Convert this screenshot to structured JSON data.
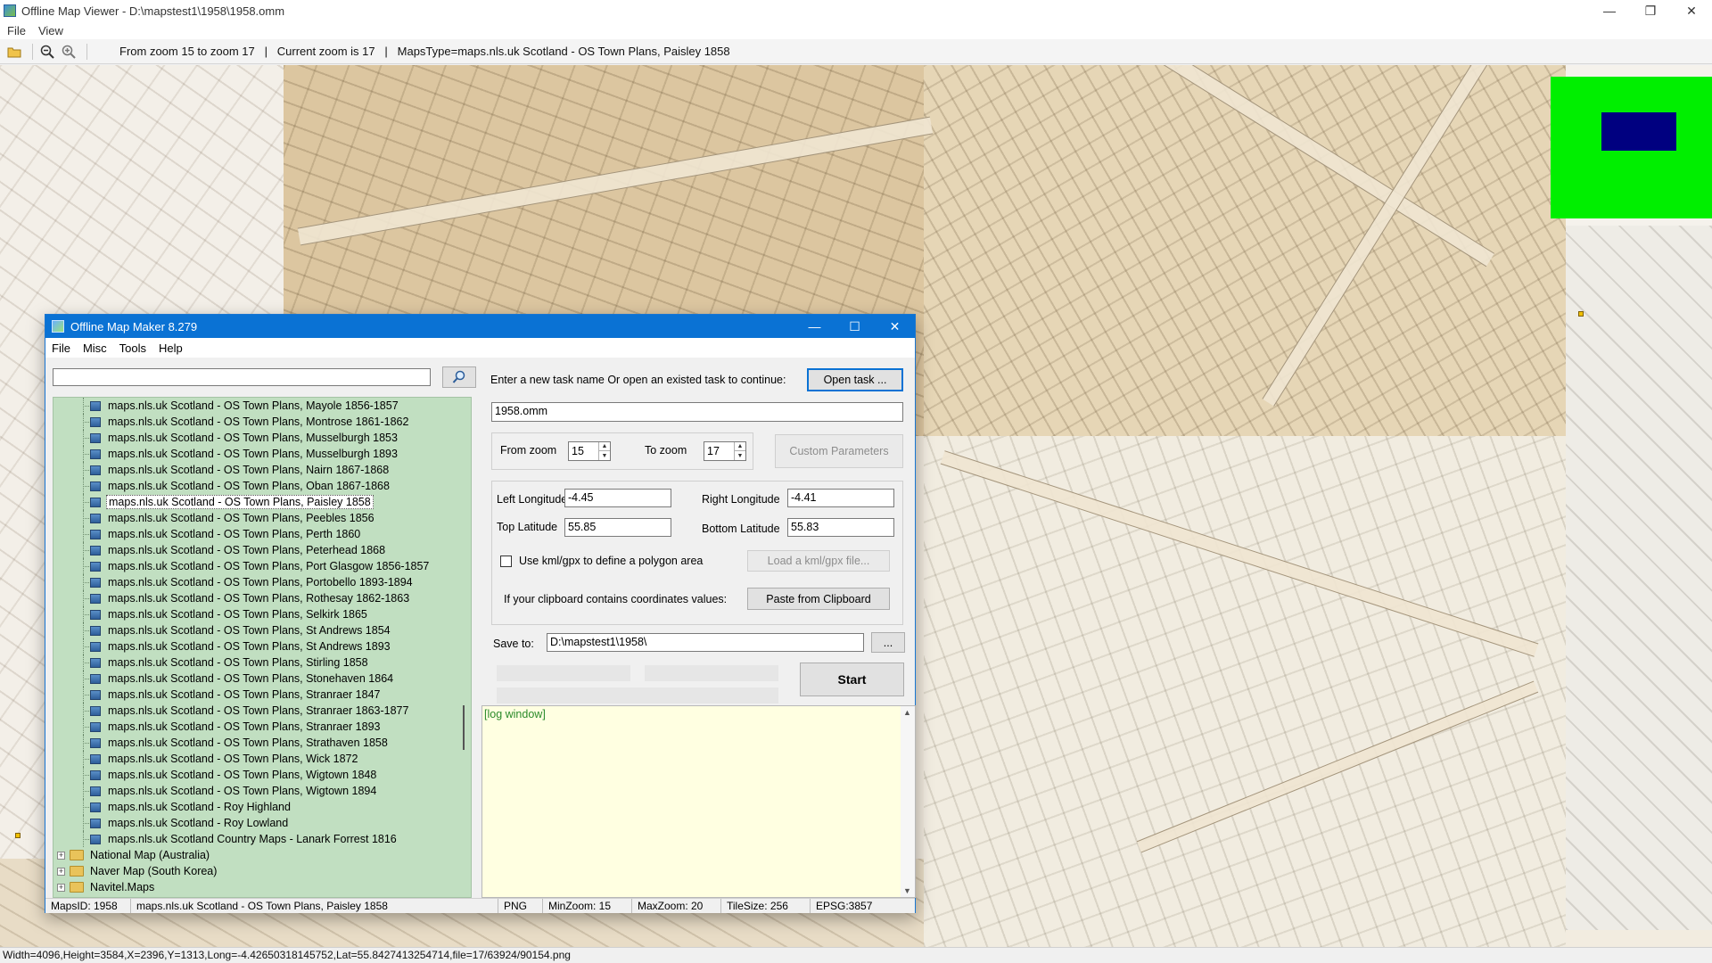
{
  "viewer": {
    "title": "Offline Map Viewer - D:\\mapstest1\\1958\\1958.omm",
    "menu": [
      "File",
      "View"
    ],
    "window_controls": {
      "minimize": "—",
      "maximize": "❐",
      "close": "✕"
    },
    "toolbar_status": "From zoom 15 to zoom 17   |   Current zoom is 17   |   MapsType=maps.nls.uk Scotland - OS Town Plans, Paisley 1858",
    "statusbar": "Width=4096,Height=3584,X=2396,Y=1313,Long=-4.42650318145752,Lat=55.8427413254714,file=17/63924/90154.png",
    "overview_colors": {
      "background": "#00ef00",
      "viewport": "#000080"
    }
  },
  "dialog": {
    "title": "Offline Map Maker 8.279",
    "menu": [
      "File",
      "Misc",
      "Tools",
      "Help"
    ],
    "window_controls": {
      "minimize": "—",
      "maximize": "☐",
      "close": "✕"
    },
    "search": {
      "value": "",
      "icon": "magnifier-icon"
    },
    "tree": {
      "maps": [
        "maps.nls.uk Scotland - OS Town Plans, Mayole 1856-1857",
        "maps.nls.uk Scotland - OS Town Plans, Montrose 1861-1862",
        "maps.nls.uk Scotland - OS Town Plans, Musselburgh 1853",
        "maps.nls.uk Scotland - OS Town Plans, Musselburgh 1893",
        "maps.nls.uk Scotland - OS Town Plans, Nairn 1867-1868",
        "maps.nls.uk Scotland - OS Town Plans, Oban 1867-1868",
        "maps.nls.uk Scotland - OS Town Plans, Paisley 1858",
        "maps.nls.uk Scotland - OS Town Plans, Peebles 1856",
        "maps.nls.uk Scotland - OS Town Plans, Perth 1860",
        "maps.nls.uk Scotland - OS Town Plans, Peterhead 1868",
        "maps.nls.uk Scotland - OS Town Plans, Port Glasgow 1856-1857",
        "maps.nls.uk Scotland - OS Town Plans, Portobello 1893-1894",
        "maps.nls.uk Scotland - OS Town Plans, Rothesay 1862-1863",
        "maps.nls.uk Scotland - OS Town Plans, Selkirk 1865",
        "maps.nls.uk Scotland - OS Town Plans, St Andrews 1854",
        "maps.nls.uk Scotland - OS Town Plans, St Andrews 1893",
        "maps.nls.uk Scotland - OS Town Plans, Stirling 1858",
        "maps.nls.uk Scotland - OS Town Plans, Stonehaven 1864",
        "maps.nls.uk Scotland - OS Town Plans, Stranraer 1847",
        "maps.nls.uk Scotland - OS Town Plans, Stranraer 1863-1877",
        "maps.nls.uk Scotland - OS Town Plans, Stranraer 1893",
        "maps.nls.uk Scotland - OS Town Plans, Strathaven 1858",
        "maps.nls.uk Scotland - OS Town Plans, Wick 1872",
        "maps.nls.uk Scotland - OS Town Plans, Wigtown 1848",
        "maps.nls.uk Scotland - OS Town Plans, Wigtown 1894",
        "maps.nls.uk Scotland - Roy Highland",
        "maps.nls.uk Scotland - Roy Lowland",
        "maps.nls.uk Scotland Country Maps - Lanark Forrest 1816"
      ],
      "selected": "maps.nls.uk Scotland - OS Town Plans, Paisley 1858",
      "folders": [
        "National Map (Australia)",
        "Naver Map (South Korea)",
        "Navitel.Maps"
      ],
      "expander_symbol": "+"
    },
    "task_prompt": "Enter a new task name Or open an existed task to continue:",
    "open_task_button": "Open task ...",
    "task_name": "1958.omm",
    "from_zoom_label": "From zoom",
    "from_zoom": "15",
    "to_zoom_label": "To zoom",
    "to_zoom": "17",
    "custom_parameters_button": "Custom Parameters",
    "left_longitude_label": "Left Longitude",
    "left_longitude": "-4.45",
    "right_longitude_label": "Right Longitude",
    "right_longitude": "-4.41",
    "top_latitude_label": "Top Latitude",
    "top_latitude": "55.85",
    "bottom_latitude_label": "Bottom Latitude",
    "bottom_latitude": "55.83",
    "kml_checkbox_label": "Use kml/gpx to define a polygon area",
    "kml_checked": false,
    "load_kml_button": "Load a kml/gpx file...",
    "clipboard_label": "If your clipboard contains coordinates values:",
    "paste_button": "Paste from Clipboard",
    "save_to_label": "Save to:",
    "save_to": "D:\\mapstest1\\1958\\",
    "browse_button": "...",
    "start_button": "Start",
    "log_text": "[log window]",
    "statusbar": {
      "maps_id": "MapsID: 1958",
      "map_name": "maps.nls.uk Scotland - OS Town Plans, Paisley 1858",
      "format": "PNG",
      "min_zoom": "MinZoom: 15",
      "max_zoom": "MaxZoom: 20",
      "tile_size": "TileSize: 256",
      "epsg": "EPSG:3857"
    }
  }
}
